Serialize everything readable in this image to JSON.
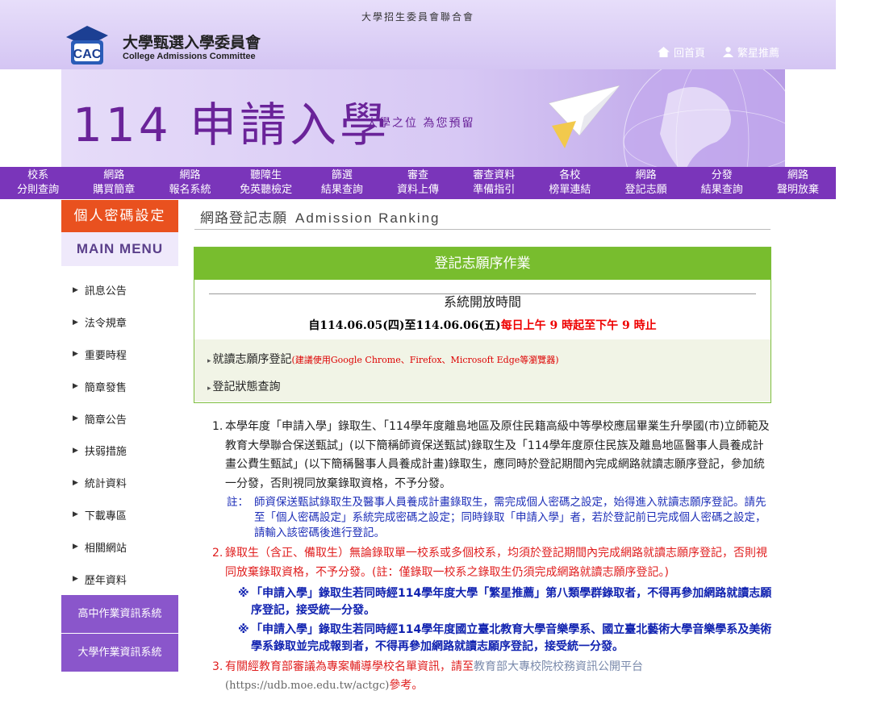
{
  "header": {
    "org": "大學招生委員會聯合會",
    "logo_cn": "大學甄選入學委員會",
    "logo_en": "College Admissions Committee",
    "home_link": "回首頁",
    "star_link": "繁星推薦"
  },
  "banner": {
    "number": "114",
    "title": "申請入學",
    "slogan": "大學之位 為您預留"
  },
  "nav": [
    {
      "l1": "校系",
      "l2": "分則查詢"
    },
    {
      "l1": "網路",
      "l2": "購買簡章"
    },
    {
      "l1": "網路",
      "l2": "報名系統"
    },
    {
      "l1": "聽障生",
      "l2": "免英聽檢定"
    },
    {
      "l1": "篩選",
      "l2": "結果查詢"
    },
    {
      "l1": "審查",
      "l2": "資料上傳"
    },
    {
      "l1": "審查資料",
      "l2": "準備指引"
    },
    {
      "l1": "各校",
      "l2": "榜單連結"
    },
    {
      "l1": "網路",
      "l2": "登記志願"
    },
    {
      "l1": "分發",
      "l2": "結果查詢"
    },
    {
      "l1": "網路",
      "l2": "聲明放棄"
    }
  ],
  "sidebar": {
    "password_button": "個人密碼設定",
    "main_menu": "MAIN MENU",
    "items": [
      "訊息公告",
      "法令規章",
      "重要時程",
      "簡章發售",
      "簡章公告",
      "扶弱措施",
      "統計資料",
      "下載專區",
      "相關網站",
      "歷年資料"
    ],
    "sys1": "高中作業資訊系統",
    "sys2": "大學作業資訊系統"
  },
  "content": {
    "title_cn": "網路登記志願",
    "title_en": "Admission Ranking",
    "box_header": "登記志願序作業",
    "open_time_label": "系統開放時間",
    "time_black": "自114.06.05(四)至114.06.06(五)",
    "time_red": "每日上午 9 時起至下午 9 時止",
    "link1": "就讀志願序登記",
    "link1_note": "(建議使用Google Chrome、Firefox、Microsoft Edge等瀏覽器)",
    "link2": "登記狀態查詢"
  },
  "notes": {
    "n1": "本學年度「申請入學」錄取生、「114學年度離島地區及原住民籍高級中等學校應屆畢業生升學國(市)立師範及教育大學聯合保送甄試」(以下簡稱師資保送甄試)錄取生及「114學年度原住民族及離島地區醫事人員養成計畫公費生甄試」(以下簡稱醫事人員養成計畫)錄取生，應同時於登記期間內完成網路就讀志願序登記，參加統一分發，否則視同放棄錄取資格，不予分發。",
    "n1_note_label": "註：",
    "n1_note": "師資保送甄試錄取生及醫事人員養成計畫錄取生，需完成個人密碼之設定，始得進入就讀志願序登記。請先至「個人密碼設定」系統完成密碼之設定；同時錄取「申請入學」者，若於登記前已完成個人密碼之設定，請輸入該密碼後進行登記。",
    "n2": "錄取生（含正、備取生）無論錄取單一校系或多個校系，均須於登記期間內完成網路就讀志願序登記，否則視同放棄錄取資格，不予分發。(註：僅錄取一校系之錄取生仍須完成網路就讀志願序登記。)",
    "star1": "「申請入學」錄取生若同時經114學年度大學「繁星推薦」第八類學群錄取者，不得再參加網路就讀志願序登記，接受統一分發。",
    "star2": "「申請入學」錄取生若同時經114學年度國立臺北教育大學音樂學系、國立臺北藝術大學音樂學系及美術學系錄取並完成報到者，不得再參加網路就讀志願序登記，接受統一分發。",
    "n3a": "有關經教育部審議為專案輔導學校名單資訊，請至",
    "n3_link": "教育部大專校院校務資訊公開平台",
    "n3_url": "(https://udb.moe.edu.tw/actgc)",
    "n3b": "參考。",
    "star_mark": "※"
  },
  "colors": {
    "nav_purple": "#7a35ba",
    "orange": "#e9511f",
    "green": "#78bd2e",
    "red": "#e01e1e",
    "blue": "#1e2fb8"
  }
}
